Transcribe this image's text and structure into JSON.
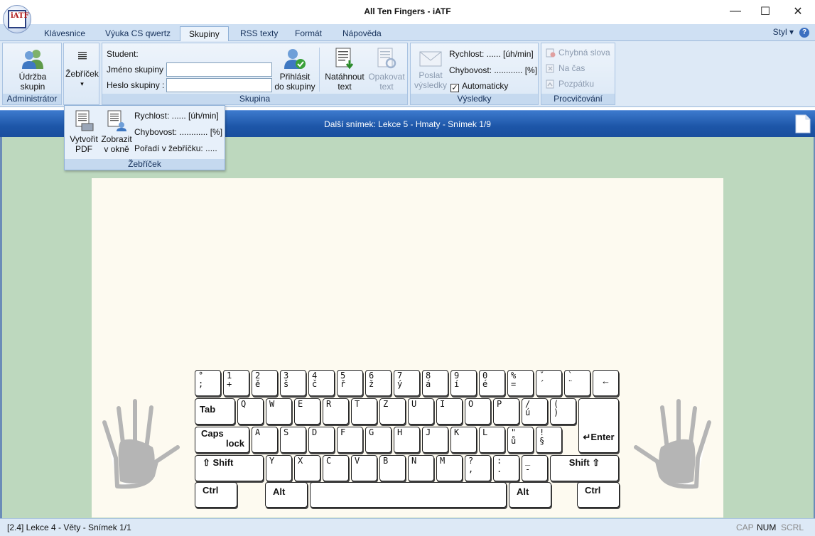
{
  "window": {
    "title": "All Ten Fingers - iATF",
    "logo_text": "iATF",
    "controls": {
      "minimize": "—",
      "maximize": "☐",
      "close": "✕"
    }
  },
  "tabs": [
    {
      "label": "Klávesnice",
      "active": false
    },
    {
      "label": "Výuka CS qwertz",
      "active": false
    },
    {
      "label": "Skupiny",
      "active": true
    },
    {
      "label": "RSS texty",
      "active": false
    },
    {
      "label": "Formát",
      "active": false
    },
    {
      "label": "Nápověda",
      "active": false
    }
  ],
  "style_menu": "Styl ▾",
  "help_glyph": "?",
  "ribbon": {
    "administrator": {
      "group_label": "Administrátor",
      "udrzba_line1": "Údržba",
      "udrzba_line2": "skupin"
    },
    "zebricek_button": {
      "label": "Žebříček",
      "arrow": "▾"
    },
    "skupina": {
      "group_label": "Skupina",
      "student_label": "Student:",
      "name_label": "Jméno skupiny :",
      "name_value": "",
      "password_label": "Heslo skupiny :",
      "password_value": "",
      "login_line1": "Přihlásit",
      "login_line2": "do skupiny",
      "load_line1": "Natáhnout",
      "load_line2": "text",
      "repeat_line1": "Opakovat",
      "repeat_line2": "text"
    },
    "vysledky": {
      "group_label": "Výsledky",
      "send_line1": "Poslat",
      "send_line2": "výsledky",
      "speed": "Rychlost: ...... [úh/min]",
      "errors": "Chybovost: ............ [%]",
      "auto_checked": true,
      "auto_label": "Automaticky"
    },
    "procvicovani": {
      "group_label": "Procvičování",
      "items": [
        "Chybná slova",
        "Na čas",
        "Pozpátku"
      ]
    }
  },
  "dropdown": {
    "group_label": "Žebříček",
    "pdf_line1": "Vytvořit",
    "pdf_line2": "PDF",
    "show_line1": "Zobrazit",
    "show_line2": "v okně",
    "speed": "Rychlost: ...... [úh/min]",
    "errors": "Chybovost: ............ [%]",
    "rank": "Pořadí v žebříčku: ....."
  },
  "infobar": {
    "text": "Další snímek: Lekce 5 - Hmaty - Snímek 1/9"
  },
  "keyboard": {
    "row1": [
      [
        "°",
        ";"
      ],
      [
        "1",
        "+"
      ],
      [
        "2",
        "ě"
      ],
      [
        "3",
        "š"
      ],
      [
        "4",
        "č"
      ],
      [
        "5",
        "ř"
      ],
      [
        "6",
        "ž"
      ],
      [
        "7",
        "ý"
      ],
      [
        "8",
        "á"
      ],
      [
        "9",
        "í"
      ],
      [
        "0",
        "é"
      ],
      [
        "%",
        "="
      ],
      [
        "ˇ",
        "´"
      ],
      [
        "`",
        "¨"
      ]
    ],
    "backspace": "←",
    "tab": "Tab",
    "row2": [
      "Q",
      "W",
      "E",
      "R",
      "T",
      "Z",
      "U",
      "I",
      "O",
      "P",
      [
        "/",
        "ú"
      ],
      [
        "(",
        ")"
      ]
    ],
    "caps_line1": "Caps",
    "caps_line2": "lock",
    "row3": [
      "A",
      "S",
      "D",
      "F",
      "G",
      "H",
      "J",
      "K",
      "L",
      [
        "\"",
        "ů"
      ],
      [
        "!",
        "§"
      ]
    ],
    "enter": "↵Enter",
    "shift_left": "⇧  Shift",
    "row4": [
      "Y",
      "X",
      "C",
      "V",
      "B",
      "N",
      "M",
      [
        "?",
        ","
      ],
      [
        ":",
        "."
      ],
      [
        "_",
        "-"
      ]
    ],
    "shift_right": "Shift  ⇧",
    "ctrl": "Ctrl",
    "alt": "Alt"
  },
  "statusbar": {
    "left": "[2.4]  Lekce 4 - Věty - Snímek 1/1",
    "cap": "CAP",
    "num": "NUM",
    "scrl": "SCRL"
  }
}
